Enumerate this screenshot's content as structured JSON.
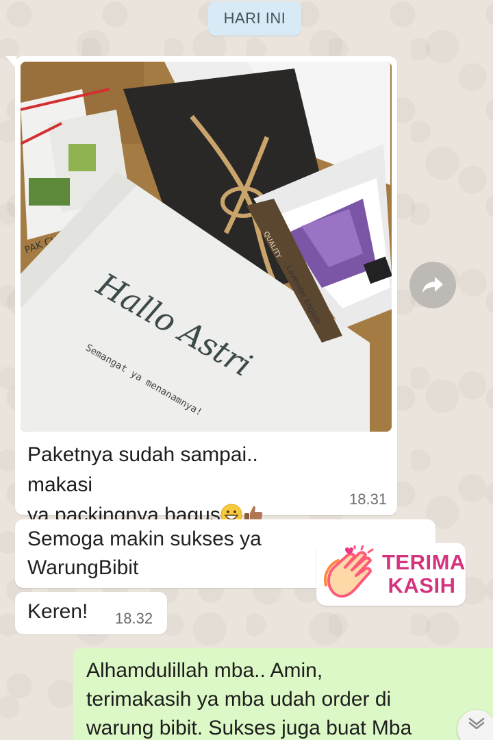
{
  "date_chip": "HARI INI",
  "photo": {
    "card_name": "Hallo Astri",
    "card_subtext": "Semangat ya menanamnya!",
    "packet_label_left": "PAK CHOY",
    "packet_label_right": "Lavender English",
    "quality_label": "QUALITY"
  },
  "messages": [
    {
      "caption_line1": "Paketnya sudah sampai.. makasi",
      "caption_line2": "ya packingnya bagus",
      "emojis": [
        "grinning-face",
        "thumbs-up"
      ],
      "time": "18.31"
    },
    {
      "text_line1": "Semoga makin sukses ya",
      "text_line2": "WarungBibit"
    },
    {
      "text": "Keren!",
      "time": "18.32"
    }
  ],
  "sticker": {
    "line1": "TERIMA",
    "line2": "KASIH"
  },
  "outgoing": {
    "text": "Alhamdulillah mba.. Amin,\nterimakasih ya mba udah order di\nwarung bibit. Sukses juga buat Mba"
  },
  "icons": {
    "forward": "forward-arrow-icon",
    "scroll_down": "chevron-down-icon",
    "sticker": "clapping-hands-icon"
  },
  "colors": {
    "incoming_bubble": "#ffffff",
    "outgoing_bubble": "#dcf8c6",
    "date_chip": "#d8eaf6",
    "sticker_text": "#d6337f"
  }
}
